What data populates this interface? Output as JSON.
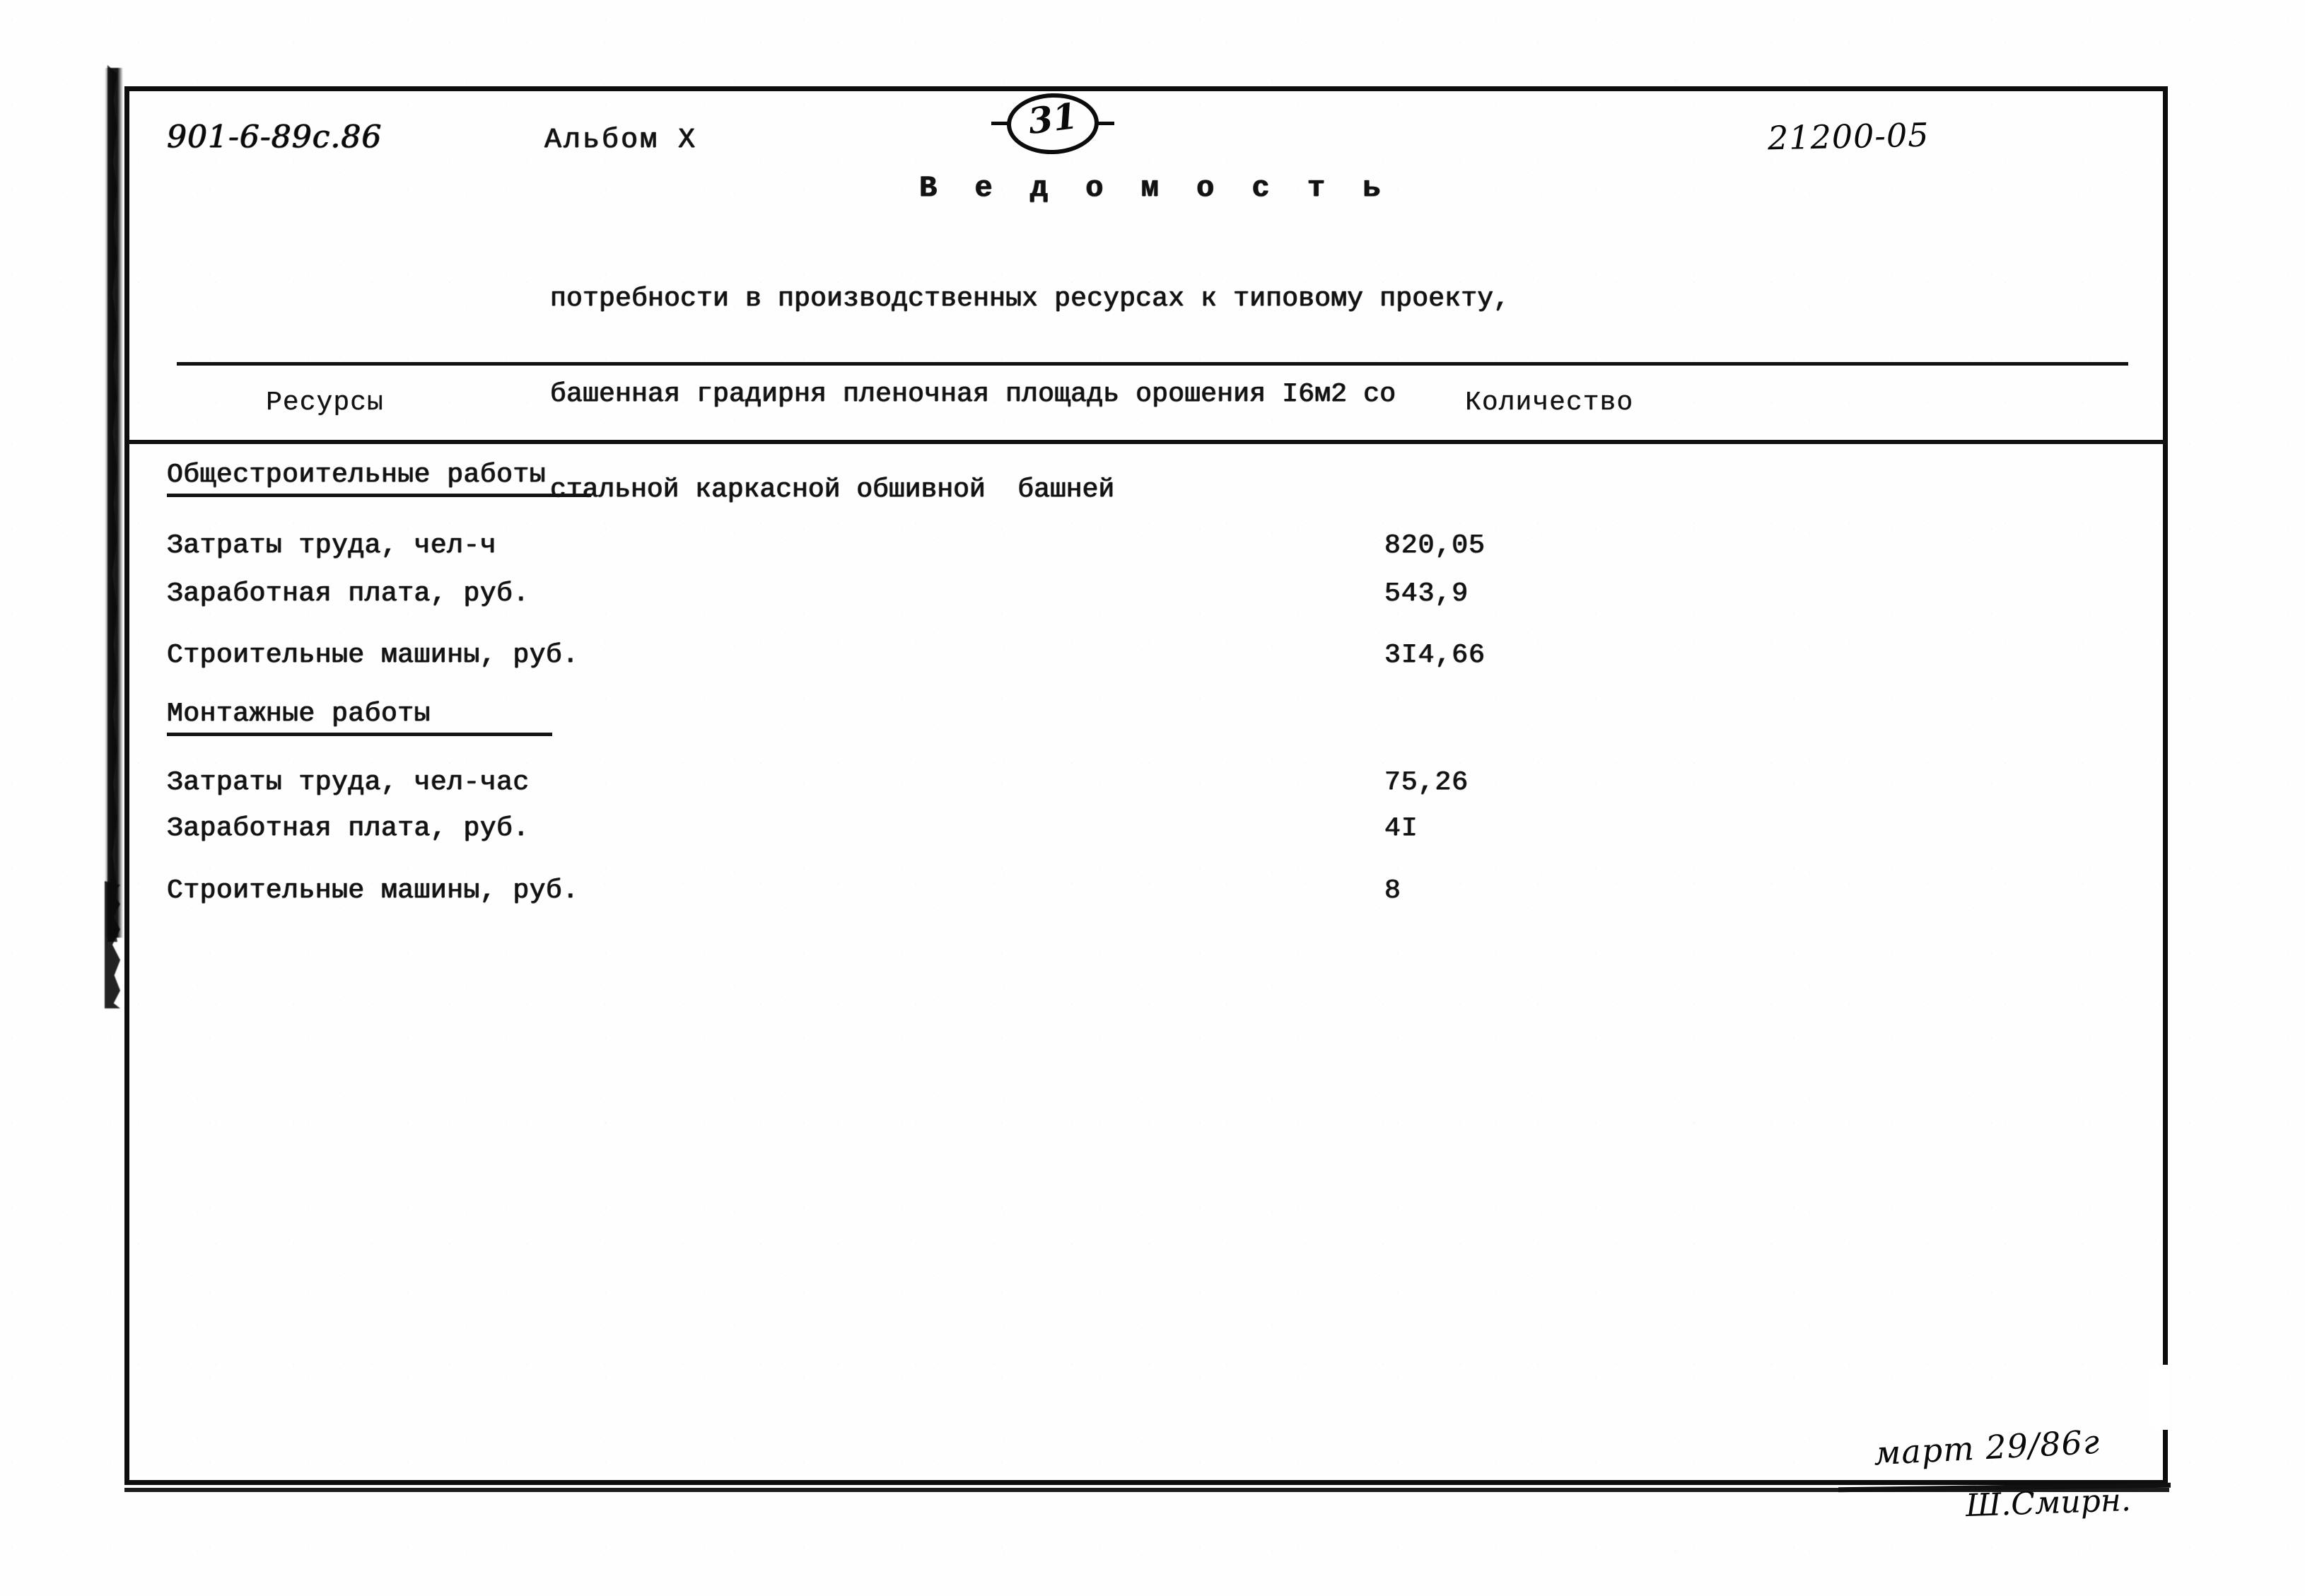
{
  "header": {
    "doc_code": "901-6-89с.86",
    "album_label": "Альбом X",
    "sheet_number": "31",
    "registration_code": "21200-05"
  },
  "title": {
    "main": "В е д о м о с т ь",
    "subtitle_lines": [
      "потребности в производственных ресурсах к типовому проекту,",
      "башенная градирня пленочная площадь орошения I6м2 со",
      "стальной каркасной обшивной  башней"
    ]
  },
  "table": {
    "columns": {
      "resources": "Ресурсы",
      "quantity": "Количество"
    },
    "sections": [
      {
        "heading": "Общестроительные работы",
        "rows": [
          {
            "label": "Затраты труда, чел-ч",
            "value": "820,05"
          },
          {
            "label": "Заработная плата, руб.",
            "value": "543,9"
          },
          {
            "label": "Строительные машины, руб.",
            "value": "3I4,66"
          }
        ]
      },
      {
        "heading": "Монтажные работы",
        "rows": [
          {
            "label": "Затраты труда, чел-час",
            "value": "75,26"
          },
          {
            "label": "Заработная плата, руб.",
            "value": "4I"
          },
          {
            "label": "Строительные машины, руб.",
            "value": "8"
          }
        ]
      }
    ]
  },
  "approval": {
    "date": "март 29/86г",
    "signature": "Ш.Смирн."
  },
  "colors": {
    "ink": "#121212",
    "paper": "#fefefe"
  }
}
